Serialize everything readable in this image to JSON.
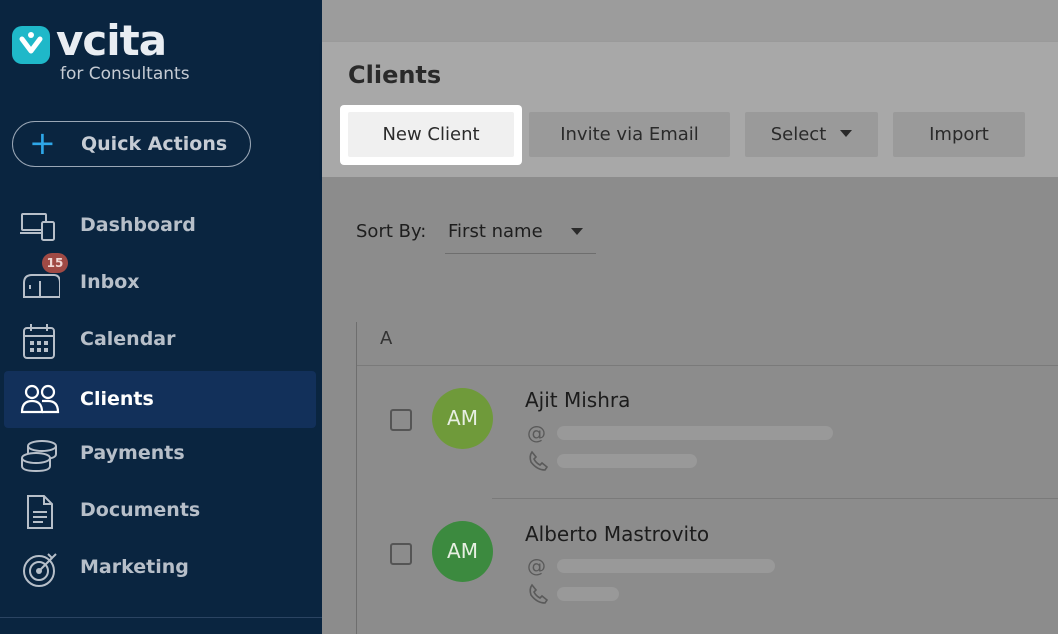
{
  "brand": {
    "name": "vcita",
    "subtitle": "for Consultants",
    "accent": "#1fb8c9"
  },
  "sidebar": {
    "quick_actions": {
      "icon": "plus-icon",
      "label": "Quick Actions"
    },
    "items": [
      {
        "id": "dashboard",
        "icon": "monitor-icon",
        "label": "Dashboard"
      },
      {
        "id": "inbox",
        "icon": "mailbox-icon",
        "label": "Inbox",
        "badge": "15"
      },
      {
        "id": "calendar",
        "icon": "calendar-icon",
        "label": "Calendar"
      },
      {
        "id": "clients",
        "icon": "users-icon",
        "label": "Clients",
        "active": true
      },
      {
        "id": "payments",
        "icon": "coins-icon",
        "label": "Payments"
      },
      {
        "id": "documents",
        "icon": "document-icon",
        "label": "Documents"
      },
      {
        "id": "marketing",
        "icon": "target-icon",
        "label": "Marketing"
      }
    ]
  },
  "page": {
    "title": "Clients"
  },
  "toolbar": {
    "new_client": "New Client",
    "invite": "Invite via Email",
    "select": "Select",
    "import": "Import"
  },
  "sort": {
    "label": "Sort By:",
    "value": "First name"
  },
  "list": {
    "group": "A",
    "clients": [
      {
        "initials": "AM",
        "name": "Ajit Mishra",
        "avatar_color": "#6f9a3a",
        "email_icon": "@",
        "phone_icon": "phone-icon"
      },
      {
        "initials": "AM",
        "name": "Alberto Mastrovito",
        "avatar_color": "#3c8a3f",
        "email_icon": "@",
        "phone_icon": "phone-icon"
      }
    ]
  }
}
